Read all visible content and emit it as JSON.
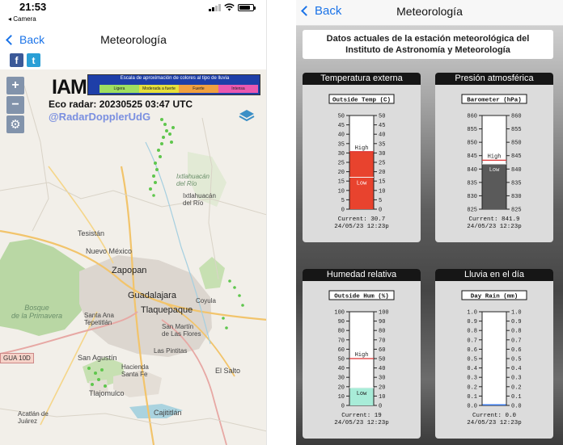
{
  "left": {
    "status_time": "21:53",
    "back_app": "◂ Camera",
    "nav": {
      "back_label": "Back",
      "title": "Meteorología"
    },
    "map": {
      "logo_text": "IAM",
      "legend_title": "Escala de aproximación de colores al tipo de lluvia",
      "legend_segments": [
        {
          "label": "Ligera",
          "color": "#9fdf60"
        },
        {
          "label": "Moderada a fuerte",
          "color": "#e6e03c"
        },
        {
          "label": "Fuerte",
          "color": "#f0a040"
        },
        {
          "label": "Intensa",
          "color": "#ea58b0"
        }
      ],
      "radar_text": "Eco radar: 20230525 03:47 UTC",
      "radar_handle": "@RadarDopplerUdG",
      "zoom_in": "+",
      "zoom_out": "−",
      "settings_icon": "gear-icon",
      "layers_icon": "layers-icon",
      "road_shield": "GUA 10D",
      "places": {
        "ixtlahuacan_it": "Ixtlahuacán\ndel Río",
        "ixtlahuacan": "Ixtlahuacán\ndel Río",
        "tesistan": "Tesistán",
        "nuevo_mexico": "Nuevo México",
        "zapopan": "Zapopan",
        "guadalajara": "Guadalajara",
        "tlaquepaque": "Tlaquepaque",
        "bosque": "Bosque\nde la Primavera",
        "santa_ana": "Santa Ana\nTepetitlán",
        "san_martin": "San Martín\nde Las Flores",
        "coyula": "Coyula",
        "las_pintitas": "Las Pintitas",
        "san_agustin": "San Agustín",
        "hacienda": "Hacienda\nSanta Fe",
        "el_salto": "El Salto",
        "tlajomulco": "Tlajomulco",
        "cajititlan": "Cajititlán",
        "acatlan": "Acatlán de\nJuárez"
      }
    }
  },
  "right": {
    "nav": {
      "back_label": "Back",
      "title": "Meteorología"
    },
    "header_line1": "Datos actuales de la estación meteorológica del",
    "header_line2": "Instituto de Astronomía y Meteorología",
    "panels": [
      {
        "title": "Temperatura externa",
        "gauge_title": "Outside Temp (C)",
        "ticks": [
          "50",
          "45",
          "40",
          "35",
          "30",
          "25",
          "20",
          "15",
          "10",
          "5",
          "0"
        ],
        "min": 0,
        "max": 50,
        "fill_value": 30.7,
        "high_value": 30.7,
        "low_value": 17.0,
        "fill_color": "#e8432e",
        "high_label": "High",
        "low_label": "Low",
        "current": "Current: 30.7",
        "date": "24/05/23 12:23p"
      },
      {
        "title": "Presión atmosférica",
        "gauge_title": "Barometer (hPa)",
        "ticks": [
          "860",
          "855",
          "850",
          "845",
          "840",
          "835",
          "830",
          "825"
        ],
        "min": 825,
        "max": 860,
        "fill_value": 841.9,
        "high_value": 843.3,
        "low_value": 841.9,
        "fill_color": "#5a5a5a",
        "high_label": "High",
        "low_label": "Low",
        "current": "Current: 841.9",
        "date": "24/05/23 12:23p"
      },
      {
        "title": "Humedad relativa",
        "gauge_title": "Outside Hum (%)",
        "ticks": [
          "100",
          "90",
          "80",
          "70",
          "60",
          "50",
          "40",
          "30",
          "20",
          "10",
          "0"
        ],
        "min": 0,
        "max": 100,
        "fill_value": 19,
        "high_value": 50,
        "low_value": 19,
        "fill_color": "#a8ecd8",
        "high_label": "High",
        "low_label": "Low",
        "current": "Current: 19",
        "date": "24/05/23 12:23p"
      },
      {
        "title": "Lluvia en el día",
        "gauge_title": "Day Rain (mm)",
        "ticks": [
          "1.0",
          "0.9",
          "0.8",
          "0.7",
          "0.6",
          "0.5",
          "0.4",
          "0.3",
          "0.2",
          "0.1",
          "0.0"
        ],
        "min": 0,
        "max": 1,
        "fill_value": 0.0,
        "high_value": null,
        "low_value": null,
        "fill_color": "#3a7ae8",
        "high_label": "",
        "low_label": "",
        "current": "Current: 0.0",
        "date": "24/05/23 12:23p"
      }
    ]
  }
}
